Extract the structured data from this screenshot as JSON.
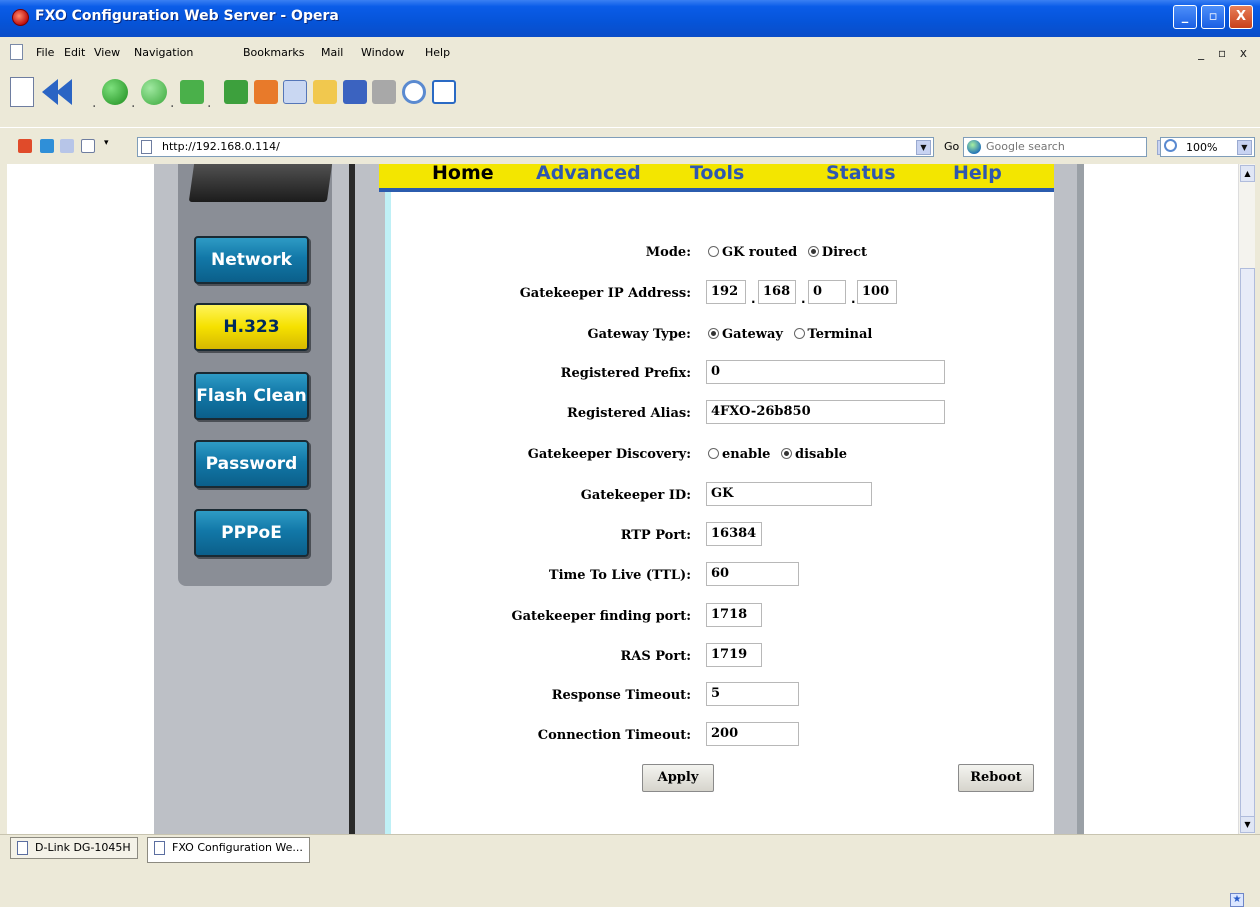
{
  "window": {
    "title": "FXO Configuration Web Server - Opera",
    "controls": {
      "minimize": "_",
      "maximize": "▫",
      "close": "X"
    }
  },
  "menubar": {
    "items": [
      "File",
      "Edit",
      "View",
      "Navigation",
      "Bookmarks",
      "Mail",
      "Window",
      "Help"
    ],
    "mdi_controls": "_ ▫ x"
  },
  "addressbar": {
    "url": "http://192.168.0.114/",
    "go_label": "Go",
    "search_placeholder": "Google search",
    "zoom": "100%"
  },
  "page": {
    "tabs": [
      "Home",
      "Advanced",
      "Tools",
      "Status",
      "Help"
    ],
    "active_tab": "Home",
    "side_buttons": [
      {
        "label": "Network",
        "active": false
      },
      {
        "label": "H.323",
        "active": true
      },
      {
        "label": "Flash Clean",
        "active": false
      },
      {
        "label": "Password",
        "active": false
      },
      {
        "label": "PPPoE",
        "active": false
      }
    ],
    "form": {
      "mode": {
        "label": "Mode:",
        "options": [
          "GK routed",
          "Direct"
        ],
        "selected": "Direct"
      },
      "gk_ip": {
        "label": "Gatekeeper IP Address:",
        "octets": [
          "192",
          "168",
          "0",
          "100"
        ]
      },
      "gateway_type": {
        "label": "Gateway Type:",
        "options": [
          "Gateway",
          "Terminal"
        ],
        "selected": "Gateway"
      },
      "registered_prefix": {
        "label": "Registered Prefix:",
        "value": "0"
      },
      "registered_alias": {
        "label": "Registered Alias:",
        "value": "4FXO-26b850"
      },
      "gk_discovery": {
        "label": "Gatekeeper Discovery:",
        "options": [
          "enable",
          "disable"
        ],
        "selected": "disable"
      },
      "gk_id": {
        "label": "Gatekeeper ID:",
        "value": "GK"
      },
      "rtp_port": {
        "label": "RTP Port:",
        "value": "16384"
      },
      "ttl": {
        "label": "Time To Live (TTL):",
        "value": "60"
      },
      "gk_finding_port": {
        "label": "Gatekeeper finding port:",
        "value": "1718"
      },
      "ras_port": {
        "label": "RAS Port:",
        "value": "1719"
      },
      "response_timeout": {
        "label": "Response Timeout:",
        "value": "5"
      },
      "connection_timeout": {
        "label": "Connection Timeout:",
        "value": "200"
      },
      "apply_label": "Apply",
      "reboot_label": "Reboot"
    }
  },
  "page_tabs": [
    {
      "label": "D-Link DG-1045H",
      "active": false
    },
    {
      "label": "FXO Configuration We...",
      "active": true
    }
  ],
  "colors": {
    "title_bar": "#0654d8",
    "tab_strip": "#f3e600",
    "nav_button": "#1278a8",
    "nav_button_active": "#f5e100",
    "side_grey": "#bdc0c6"
  }
}
